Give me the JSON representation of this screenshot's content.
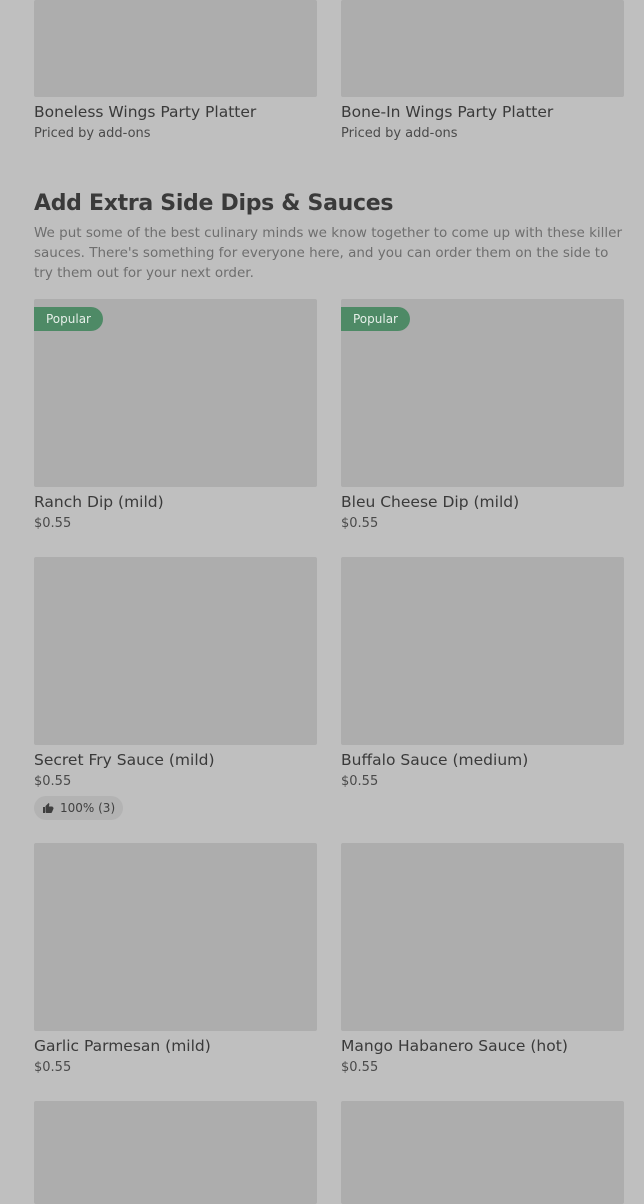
{
  "top_items": [
    {
      "name": "Boneless Wings Party Platter",
      "price": "Priced by add-ons"
    },
    {
      "name": "Bone-In Wings Party Platter",
      "price": "Priced by add-ons"
    }
  ],
  "section": {
    "title": "Add Extra Side Dips & Sauces",
    "description": "We put some of the best culinary minds we know together to come up with these killer sauces. There's something for everyone here, and you can order them on the side to try them out for your next order."
  },
  "items": [
    {
      "name": "Ranch Dip (mild)",
      "price": "$0.55",
      "badge": "Popular"
    },
    {
      "name": "Bleu Cheese Dip (mild)",
      "price": "$0.55",
      "badge": "Popular"
    },
    {
      "name": "Secret Fry Sauce (mild)",
      "price": "$0.55",
      "rating": "100% (3)"
    },
    {
      "name": "Buffalo Sauce (medium)",
      "price": "$0.55"
    },
    {
      "name": "Garlic Parmesan (mild)",
      "price": "$0.55"
    },
    {
      "name": "Mango Habanero Sauce (hot)",
      "price": "$0.55"
    }
  ],
  "icons": {
    "rating": "thumbs-up-icon"
  },
  "colors": {
    "badge": "#4e8a66",
    "background": "#bfbfbf",
    "image_placeholder": "#adadad"
  }
}
